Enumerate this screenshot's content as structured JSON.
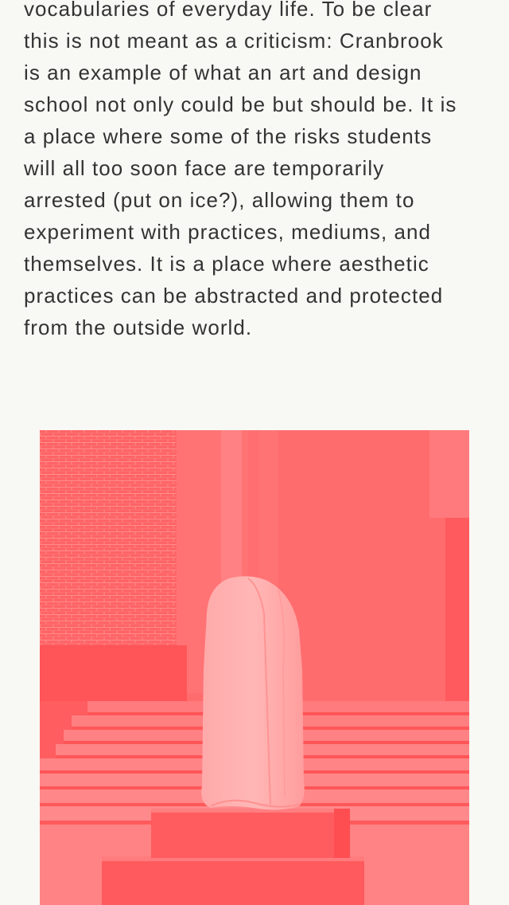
{
  "article": {
    "lines": [
      "vocabularies of everyday life. To be clear",
      "this is not meant as a criticism: Cranbrook",
      "is an example of what an art and design",
      "school not only could be but should be. It is",
      "a place where some of the risks students",
      "will all too soon face are temporarily",
      "arrested (put on ice?), allowing them to",
      "experiment with practices, mediums, and",
      "themselves. It is a place where aesthetic",
      "practices can be abstracted and protected",
      "from the outside world."
    ]
  },
  "figure": {
    "tint_color": "#ff6a6c"
  }
}
